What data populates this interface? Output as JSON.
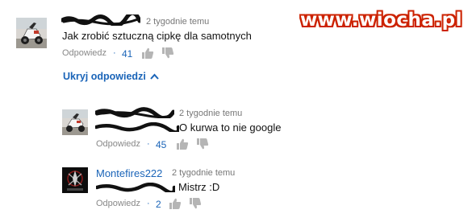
{
  "watermark": "www.wiocha.pl",
  "actions": {
    "reply_label": "Odpowiedz",
    "dot": "·"
  },
  "toggle_replies": {
    "label": "Ukryj odpowiedzi",
    "icon": "chevron-up-icon"
  },
  "comments": [
    {
      "author_hidden": true,
      "time": "2 tygodnie temu",
      "text": "Jak zrobić sztuczną cipkę dla samotnych",
      "likes": "41",
      "avatar": "scooter-photo"
    },
    {
      "author_hidden": true,
      "time": "2 tygodnie temu",
      "text_mention_hidden": true,
      "text": "O kurwa to nie google",
      "likes": "45",
      "avatar": "scooter-photo"
    },
    {
      "author": "Montefires222",
      "time": "2 tygodnie temu",
      "text_mention_hidden": true,
      "text": "Mistrz :D",
      "likes": "2",
      "avatar": "dark-logo"
    }
  ],
  "colors": {
    "link_blue": "#1a64b8",
    "watermark_red": "#cc2200",
    "scribble": "#111111",
    "icon_gray": "#b5b5b5"
  }
}
